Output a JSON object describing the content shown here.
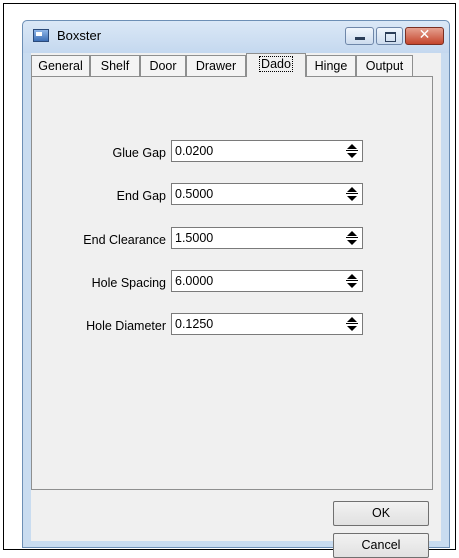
{
  "window": {
    "title": "Boxster"
  },
  "tabs": [
    {
      "label": "General"
    },
    {
      "label": "Shelf"
    },
    {
      "label": "Door"
    },
    {
      "label": "Drawer"
    },
    {
      "label": "Dado"
    },
    {
      "label": "Hinge"
    },
    {
      "label": "Output"
    }
  ],
  "active_tab": "Dado",
  "fields": [
    {
      "label": "Glue Gap",
      "value": "0.0200"
    },
    {
      "label": "End Gap",
      "value": "0.5000"
    },
    {
      "label": "End Clearance",
      "value": "1.5000"
    },
    {
      "label": "Hole Spacing",
      "value": "6.0000"
    },
    {
      "label": "Hole Diameter",
      "value": "0.1250"
    }
  ],
  "buttons": {
    "ok": "OK",
    "cancel": "Cancel"
  },
  "icons": {
    "app": "app-window-icon",
    "minimize": "minimize-icon",
    "maximize": "maximize-icon",
    "close": "close-icon",
    "spinner": "spin-updown-icon"
  },
  "colors": {
    "close_button": "#c4452c",
    "titlebar": "#c9dcf0"
  }
}
